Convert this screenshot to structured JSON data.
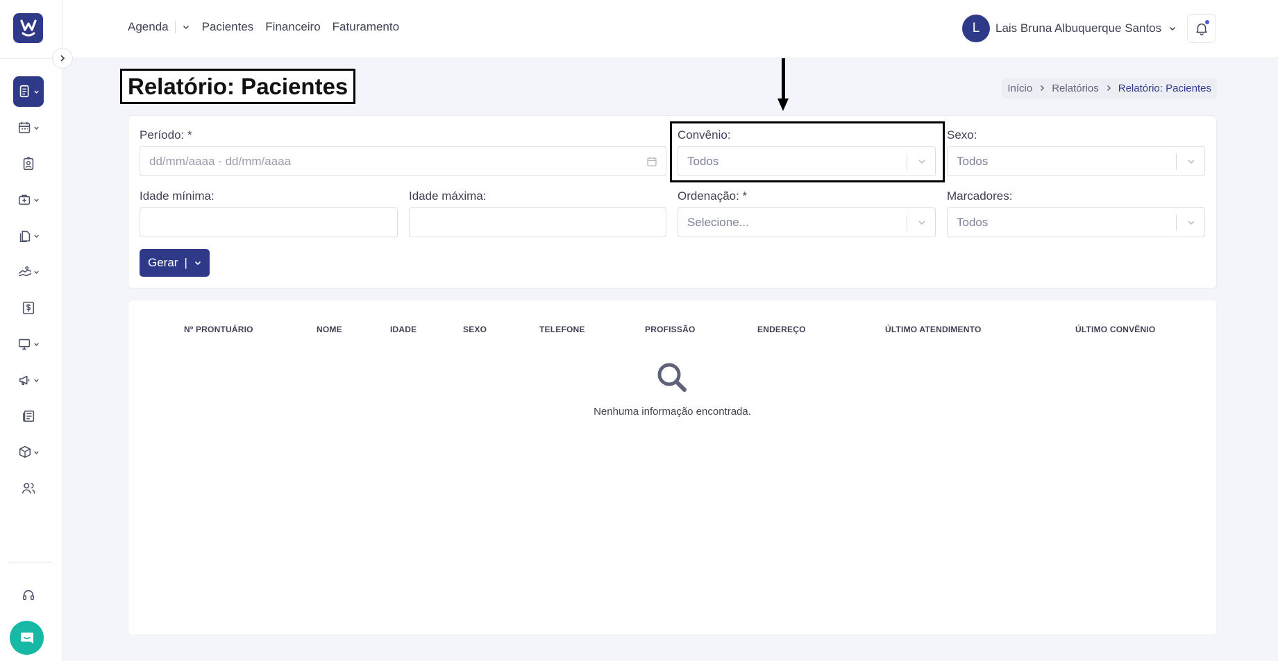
{
  "header": {
    "nav": [
      "Agenda",
      "Pacientes",
      "Financeiro",
      "Faturamento"
    ],
    "user_initial": "L",
    "user_name": "Lais Bruna Albuquerque Santos"
  },
  "page": {
    "title": "Relatório: Pacientes",
    "breadcrumb": [
      "Início",
      "Relatórios",
      "Relatório: Pacientes"
    ]
  },
  "filters": {
    "periodo": {
      "label": "Período: *",
      "placeholder": "dd/mm/aaaa - dd/mm/aaaa"
    },
    "convenio": {
      "label": "Convênio:",
      "value": "Todos"
    },
    "sexo": {
      "label": "Sexo:",
      "value": "Todos"
    },
    "idade_min": {
      "label": "Idade mínima:",
      "value": ""
    },
    "idade_max": {
      "label": "Idade máxima:",
      "value": ""
    },
    "ordenacao": {
      "label": "Ordenação: *",
      "value": "Selecione..."
    },
    "marcadores": {
      "label": "Marcadores:",
      "value": "Todos"
    },
    "generate_label": "Gerar"
  },
  "table": {
    "columns": [
      "Nº PRONTUÁRIO",
      "NOME",
      "IDADE",
      "SEXO",
      "TELEFONE",
      "PROFISSÃO",
      "ENDEREÇO",
      "ÚLTIMO ATENDIMENTO",
      "ÚLTIMO CONVÊNIO"
    ],
    "empty_message": "Nenhuma informação encontrada."
  },
  "icons": {
    "sidebar": [
      "reports-icon",
      "calendar-icon",
      "patient-badge-icon",
      "medical-kit-icon",
      "documents-icon",
      "handshake-icon",
      "dollar-icon",
      "monitor-icon",
      "megaphone-icon",
      "newspaper-icon",
      "box-icon",
      "users-icon",
      "headset-icon"
    ],
    "chat": "chat-icon"
  },
  "colors": {
    "primary": "#2e3a87",
    "chat": "#17b8a6",
    "background": "#f4f5fb"
  }
}
